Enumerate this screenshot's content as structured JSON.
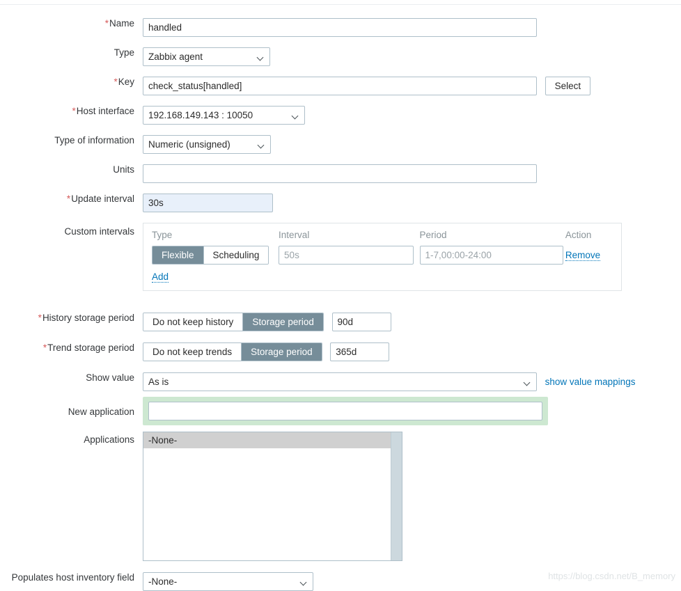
{
  "form": {
    "rows": {
      "name": {
        "label": "Name",
        "required": true,
        "value": "handled",
        "placeholder": ""
      },
      "type": {
        "label": "Type",
        "required": false,
        "value": "Zabbix agent"
      },
      "key": {
        "label": "Key",
        "required": true,
        "value": "check_status[handled]",
        "placeholder": "",
        "select_button": "Select"
      },
      "host_interface": {
        "label": "Host interface",
        "required": true,
        "value": "192.168.149.143 : 10050"
      },
      "type_of_information": {
        "label": "Type of information",
        "required": false,
        "value": "Numeric (unsigned)"
      },
      "units": {
        "label": "Units",
        "required": false,
        "value": "",
        "placeholder": ""
      },
      "update_interval": {
        "label": "Update interval",
        "required": true,
        "value": "30s",
        "placeholder": ""
      },
      "custom_intervals": {
        "label": "Custom intervals",
        "required": false,
        "columns": [
          "Type",
          "Interval",
          "Period",
          "Action"
        ],
        "rows": [
          {
            "type_options": [
              "Flexible",
              "Scheduling"
            ],
            "type_selected": "Flexible",
            "interval_value": "",
            "interval_placeholder": "50s",
            "period_value": "",
            "period_placeholder": "1-7,00:00-24:00",
            "action": "Remove"
          }
        ],
        "add_label": "Add"
      },
      "history_storage_period": {
        "label": "History storage period",
        "required": true,
        "options": [
          "Do not keep history",
          "Storage period"
        ],
        "selected": "Storage period",
        "value": "90d"
      },
      "trend_storage_period": {
        "label": "Trend storage period",
        "required": true,
        "options": [
          "Do not keep trends",
          "Storage period"
        ],
        "selected": "Storage period",
        "value": "365d"
      },
      "show_value": {
        "label": "Show value",
        "required": false,
        "value": "As is",
        "link": "show value mappings"
      },
      "new_application": {
        "label": "New application",
        "required": false,
        "value": "",
        "placeholder": ""
      },
      "applications": {
        "label": "Applications",
        "required": false,
        "items": [
          "-None-"
        ],
        "selected": "-None-"
      },
      "populates_host_inventory_field": {
        "label": "Populates host inventory field",
        "required": false,
        "value": "-None-"
      }
    }
  },
  "watermark": "https://blog.csdn.net/B_memory",
  "colors": {
    "accent_link": "#0275b8",
    "segment_selected": "#768d99",
    "required_star": "#d65b5b",
    "highlight_green": "#cde8d1",
    "focus_blue": "#e8f0fa"
  }
}
